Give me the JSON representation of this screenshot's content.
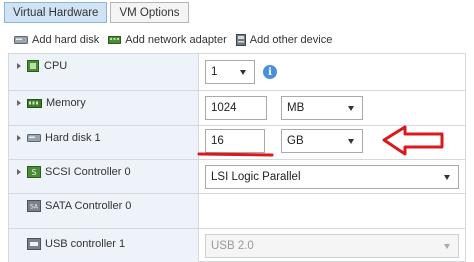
{
  "tabs": [
    {
      "label": "Virtual Hardware"
    },
    {
      "label": "VM Options"
    }
  ],
  "toolbar": {
    "add_hard_disk": "Add hard disk",
    "add_network_adapter": "Add network adapter",
    "add_other_device": "Add other device"
  },
  "rows": {
    "cpu": {
      "label": "CPU",
      "value": "1"
    },
    "memory": {
      "label": "Memory",
      "value": "1024",
      "unit": "MB"
    },
    "hard_disk": {
      "label": "Hard disk 1",
      "value": "16",
      "unit": "GB"
    },
    "scsi": {
      "label": "SCSI Controller 0",
      "value": "LSI Logic Parallel"
    },
    "sata": {
      "label": "SATA Controller 0"
    },
    "usb": {
      "label": "USB controller 1",
      "value": "USB 2.0"
    }
  },
  "colors": {
    "annotation_red": "#d9191b",
    "tab_active_bg": "#cfe3f4",
    "left_column_bg": "#eef3f9",
    "info_blue": "#4a90d9"
  },
  "icons": [
    "hard-disk-icon",
    "network-adapter-icon",
    "other-device-icon",
    "cpu-icon",
    "memory-icon",
    "scsi-icon",
    "sata-icon",
    "usb-icon",
    "info-icon"
  ]
}
